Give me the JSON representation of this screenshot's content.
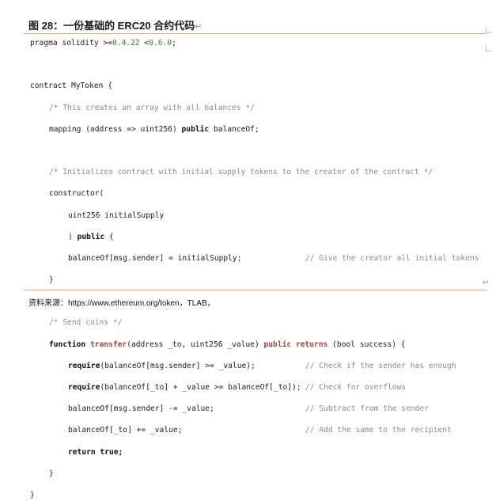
{
  "figure": {
    "title": "图 28：一份基础的 ERC20 合约代码",
    "paragraph_mark": "↵",
    "source_prefix": "资料来源：",
    "source_url": "https://www.ethereum.org/token",
    "source_suffix": "，TLAB，"
  },
  "code": {
    "l1_a": "pragma solidity >=",
    "l1_v1": "0.4.22",
    "l1_b": " <",
    "l1_v2": "0.6.0",
    "l1_c": ";",
    "l3": "contract MyToken {",
    "l4": "/* This creates an array with all balances */",
    "l5_a": "mapping (address => uint256) ",
    "l5_kw": "public",
    "l5_b": " balanceOf;",
    "l7": "/* Initializes contract with initial supply tokens to the creator of the contract */",
    "l8": "constructor(",
    "l9": "uint256 initialSupply",
    "l10_a": ") ",
    "l10_kw": "public",
    "l10_b": " {",
    "l11_code": "balanceOf[msg.sender] = initialSupply;",
    "l11_cm": "// Give the creator all initial tokens",
    "l12": "}",
    "l14": "/* Send coins */",
    "l15_kw1": "function",
    "l15_fn": "transfer",
    "l15_a": "(address _to, uint256 _value) ",
    "l15_kw2": "public",
    "l15_kw3": "returns",
    "l15_b": " (bool success) {",
    "l16_kw": "require",
    "l16_code": "(balanceOf[msg.sender] >= _value);",
    "l16_cm": "// Check if the sender has enough",
    "l17_kw": "require",
    "l17_code": "(balanceOf[_to] + _value >= balanceOf[_to]);",
    "l17_cm": "// Check for overflows",
    "l18_code": "balanceOf[msg.sender] -= _value;",
    "l18_cm": "// Subtract from the sender",
    "l19_code": "balanceOf[_to] += _value;",
    "l19_cm": "// Add the same to the recipient",
    "l20_kw": "return",
    "l20_code": " true;",
    "l21": "}",
    "l22": "}"
  }
}
